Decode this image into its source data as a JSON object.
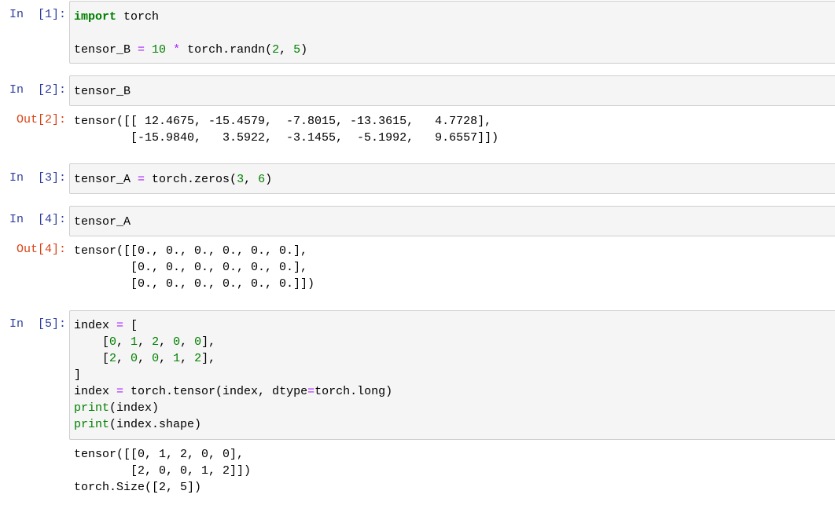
{
  "cells": [
    {
      "in_prompt": "In  [1]:",
      "code": [
        [
          {
            "t": "kw",
            "v": "import"
          },
          {
            "t": "",
            "v": " torch"
          }
        ],
        [
          {
            "t": "",
            "v": ""
          }
        ],
        [
          {
            "t": "",
            "v": "tensor_B "
          },
          {
            "t": "op",
            "v": "="
          },
          {
            "t": "",
            "v": " "
          },
          {
            "t": "num",
            "v": "10"
          },
          {
            "t": "",
            "v": " "
          },
          {
            "t": "op",
            "v": "*"
          },
          {
            "t": "",
            "v": " torch.randn("
          },
          {
            "t": "num",
            "v": "2"
          },
          {
            "t": "",
            "v": ", "
          },
          {
            "t": "num",
            "v": "5"
          },
          {
            "t": "",
            "v": ")"
          }
        ]
      ]
    },
    {
      "in_prompt": "In  [2]:",
      "code": [
        [
          {
            "t": "",
            "v": "tensor_B"
          }
        ]
      ],
      "out_prompt": "Out[2]:",
      "output": [
        "tensor([[ 12.4675, -15.4579,  -7.8015, -13.3615,   4.7728],",
        "        [-15.9840,   3.5922,  -3.1455,  -5.1992,   9.6557]])"
      ]
    },
    {
      "in_prompt": "In  [3]:",
      "code": [
        [
          {
            "t": "",
            "v": "tensor_A "
          },
          {
            "t": "op",
            "v": "="
          },
          {
            "t": "",
            "v": " torch.zeros("
          },
          {
            "t": "num",
            "v": "3"
          },
          {
            "t": "",
            "v": ", "
          },
          {
            "t": "num",
            "v": "6"
          },
          {
            "t": "",
            "v": ")"
          }
        ]
      ]
    },
    {
      "in_prompt": "In  [4]:",
      "code": [
        [
          {
            "t": "",
            "v": "tensor_A"
          }
        ]
      ],
      "out_prompt": "Out[4]:",
      "output": [
        "tensor([[0., 0., 0., 0., 0., 0.],",
        "        [0., 0., 0., 0., 0., 0.],",
        "        [0., 0., 0., 0., 0., 0.]])"
      ]
    },
    {
      "in_prompt": "In  [5]:",
      "code": [
        [
          {
            "t": "",
            "v": "index "
          },
          {
            "t": "op",
            "v": "="
          },
          {
            "t": "",
            "v": " ["
          }
        ],
        [
          {
            "t": "",
            "v": "    ["
          },
          {
            "t": "num",
            "v": "0"
          },
          {
            "t": "",
            "v": ", "
          },
          {
            "t": "num",
            "v": "1"
          },
          {
            "t": "",
            "v": ", "
          },
          {
            "t": "num",
            "v": "2"
          },
          {
            "t": "",
            "v": ", "
          },
          {
            "t": "num",
            "v": "0"
          },
          {
            "t": "",
            "v": ", "
          },
          {
            "t": "num",
            "v": "0"
          },
          {
            "t": "",
            "v": "],"
          }
        ],
        [
          {
            "t": "",
            "v": "    ["
          },
          {
            "t": "num",
            "v": "2"
          },
          {
            "t": "",
            "v": ", "
          },
          {
            "t": "num",
            "v": "0"
          },
          {
            "t": "",
            "v": ", "
          },
          {
            "t": "num",
            "v": "0"
          },
          {
            "t": "",
            "v": ", "
          },
          {
            "t": "num",
            "v": "1"
          },
          {
            "t": "",
            "v": ", "
          },
          {
            "t": "num",
            "v": "2"
          },
          {
            "t": "",
            "v": "],"
          }
        ],
        [
          {
            "t": "",
            "v": "]"
          }
        ],
        [
          {
            "t": "",
            "v": "index "
          },
          {
            "t": "op",
            "v": "="
          },
          {
            "t": "",
            "v": " torch.tensor(index, dtype"
          },
          {
            "t": "op",
            "v": "="
          },
          {
            "t": "",
            "v": "torch.long)"
          }
        ],
        [
          {
            "t": "bi",
            "v": "print"
          },
          {
            "t": "",
            "v": "(index)"
          }
        ],
        [
          {
            "t": "bi",
            "v": "print"
          },
          {
            "t": "",
            "v": "(index.shape)"
          }
        ]
      ],
      "output": [
        "tensor([[0, 1, 2, 0, 0],",
        "        [2, 0, 0, 1, 2]])",
        "torch.Size([2, 5])"
      ]
    }
  ]
}
